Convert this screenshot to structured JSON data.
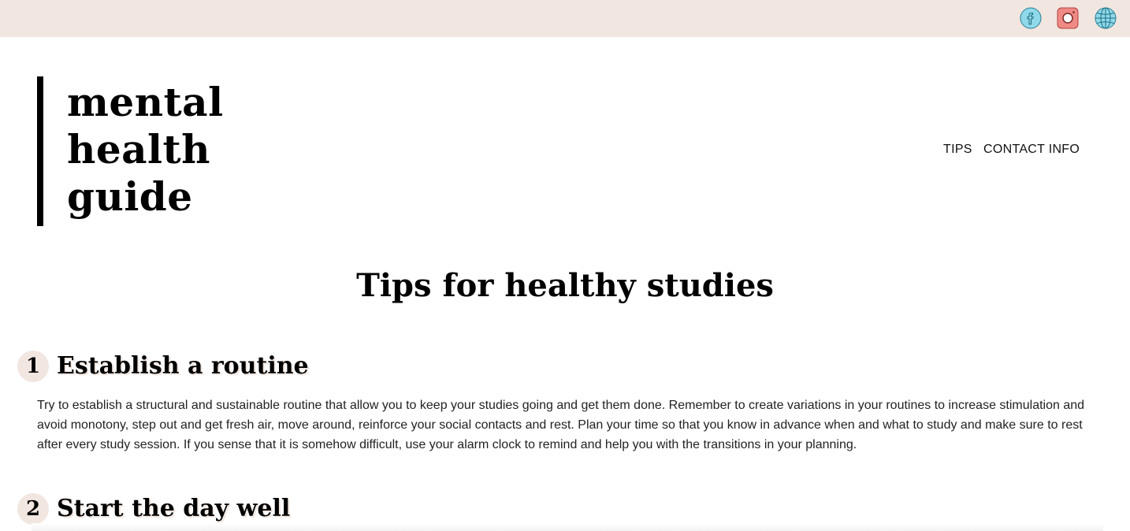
{
  "social": {
    "facebook_icon": "facebook-icon",
    "instagram_icon": "instagram-icon",
    "website_icon": "globe-icon"
  },
  "logo": {
    "line1": "mental",
    "line2": "health",
    "line3": "guide"
  },
  "nav": {
    "tips": "TIPS",
    "contact": "CONTACT INFO"
  },
  "page_title": "Tips for healthy studies",
  "tips": [
    {
      "number": "1",
      "heading": "Establish a routine",
      "body": "Try to establish a structural and sustainable routine that allow you to keep your studies going and get them done. Remember to create variations in your routines to increase stimulation and avoid monotony, step out and get fresh air, move around, reinforce your social contacts and rest. Plan your time so that you know in advance when and what to study and make sure to rest after every study session. If you sense that it is somehow difficult, use your alarm clock to remind and help you with the transitions in your planning."
    },
    {
      "number": "2",
      "heading": "Start the day well"
    }
  ],
  "colors": {
    "topbar": "#f1e6e0",
    "accent": "#f1e6e0",
    "text": "#000000"
  }
}
